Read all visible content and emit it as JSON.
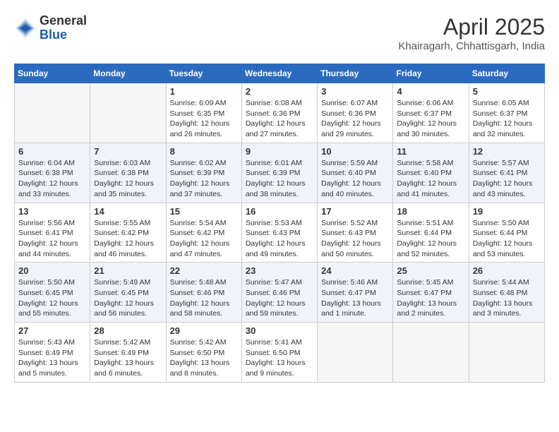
{
  "header": {
    "logo_line1": "General",
    "logo_line2": "Blue",
    "month_title": "April 2025",
    "subtitle": "Khairagarh, Chhattisgarh, India"
  },
  "days_of_week": [
    "Sunday",
    "Monday",
    "Tuesday",
    "Wednesday",
    "Thursday",
    "Friday",
    "Saturday"
  ],
  "weeks": [
    [
      {
        "day": "",
        "empty": true
      },
      {
        "day": "",
        "empty": true
      },
      {
        "day": "1",
        "sunrise": "6:09 AM",
        "sunset": "6:35 PM",
        "daylight": "12 hours and 26 minutes."
      },
      {
        "day": "2",
        "sunrise": "6:08 AM",
        "sunset": "6:36 PM",
        "daylight": "12 hours and 27 minutes."
      },
      {
        "day": "3",
        "sunrise": "6:07 AM",
        "sunset": "6:36 PM",
        "daylight": "12 hours and 29 minutes."
      },
      {
        "day": "4",
        "sunrise": "6:06 AM",
        "sunset": "6:37 PM",
        "daylight": "12 hours and 30 minutes."
      },
      {
        "day": "5",
        "sunrise": "6:05 AM",
        "sunset": "6:37 PM",
        "daylight": "12 hours and 32 minutes."
      }
    ],
    [
      {
        "day": "6",
        "sunrise": "6:04 AM",
        "sunset": "6:38 PM",
        "daylight": "12 hours and 33 minutes."
      },
      {
        "day": "7",
        "sunrise": "6:03 AM",
        "sunset": "6:38 PM",
        "daylight": "12 hours and 35 minutes."
      },
      {
        "day": "8",
        "sunrise": "6:02 AM",
        "sunset": "6:39 PM",
        "daylight": "12 hours and 37 minutes."
      },
      {
        "day": "9",
        "sunrise": "6:01 AM",
        "sunset": "6:39 PM",
        "daylight": "12 hours and 38 minutes."
      },
      {
        "day": "10",
        "sunrise": "5:59 AM",
        "sunset": "6:40 PM",
        "daylight": "12 hours and 40 minutes."
      },
      {
        "day": "11",
        "sunrise": "5:58 AM",
        "sunset": "6:40 PM",
        "daylight": "12 hours and 41 minutes."
      },
      {
        "day": "12",
        "sunrise": "5:57 AM",
        "sunset": "6:41 PM",
        "daylight": "12 hours and 43 minutes."
      }
    ],
    [
      {
        "day": "13",
        "sunrise": "5:56 AM",
        "sunset": "6:41 PM",
        "daylight": "12 hours and 44 minutes."
      },
      {
        "day": "14",
        "sunrise": "5:55 AM",
        "sunset": "6:42 PM",
        "daylight": "12 hours and 46 minutes."
      },
      {
        "day": "15",
        "sunrise": "5:54 AM",
        "sunset": "6:42 PM",
        "daylight": "12 hours and 47 minutes."
      },
      {
        "day": "16",
        "sunrise": "5:53 AM",
        "sunset": "6:43 PM",
        "daylight": "12 hours and 49 minutes."
      },
      {
        "day": "17",
        "sunrise": "5:52 AM",
        "sunset": "6:43 PM",
        "daylight": "12 hours and 50 minutes."
      },
      {
        "day": "18",
        "sunrise": "5:51 AM",
        "sunset": "6:44 PM",
        "daylight": "12 hours and 52 minutes."
      },
      {
        "day": "19",
        "sunrise": "5:50 AM",
        "sunset": "6:44 PM",
        "daylight": "12 hours and 53 minutes."
      }
    ],
    [
      {
        "day": "20",
        "sunrise": "5:50 AM",
        "sunset": "6:45 PM",
        "daylight": "12 hours and 55 minutes."
      },
      {
        "day": "21",
        "sunrise": "5:49 AM",
        "sunset": "6:45 PM",
        "daylight": "12 hours and 56 minutes."
      },
      {
        "day": "22",
        "sunrise": "5:48 AM",
        "sunset": "6:46 PM",
        "daylight": "12 hours and 58 minutes."
      },
      {
        "day": "23",
        "sunrise": "5:47 AM",
        "sunset": "6:46 PM",
        "daylight": "12 hours and 59 minutes."
      },
      {
        "day": "24",
        "sunrise": "5:46 AM",
        "sunset": "6:47 PM",
        "daylight": "13 hours and 1 minute."
      },
      {
        "day": "25",
        "sunrise": "5:45 AM",
        "sunset": "6:47 PM",
        "daylight": "13 hours and 2 minutes."
      },
      {
        "day": "26",
        "sunrise": "5:44 AM",
        "sunset": "6:48 PM",
        "daylight": "13 hours and 3 minutes."
      }
    ],
    [
      {
        "day": "27",
        "sunrise": "5:43 AM",
        "sunset": "6:49 PM",
        "daylight": "13 hours and 5 minutes."
      },
      {
        "day": "28",
        "sunrise": "5:42 AM",
        "sunset": "6:49 PM",
        "daylight": "13 hours and 6 minutes."
      },
      {
        "day": "29",
        "sunrise": "5:42 AM",
        "sunset": "6:50 PM",
        "daylight": "13 hours and 8 minutes."
      },
      {
        "day": "30",
        "sunrise": "5:41 AM",
        "sunset": "6:50 PM",
        "daylight": "13 hours and 9 minutes."
      },
      {
        "day": "",
        "empty": true
      },
      {
        "day": "",
        "empty": true
      },
      {
        "day": "",
        "empty": true
      }
    ]
  ],
  "labels": {
    "sunrise": "Sunrise: ",
    "sunset": "Sunset: ",
    "daylight": "Daylight: "
  }
}
